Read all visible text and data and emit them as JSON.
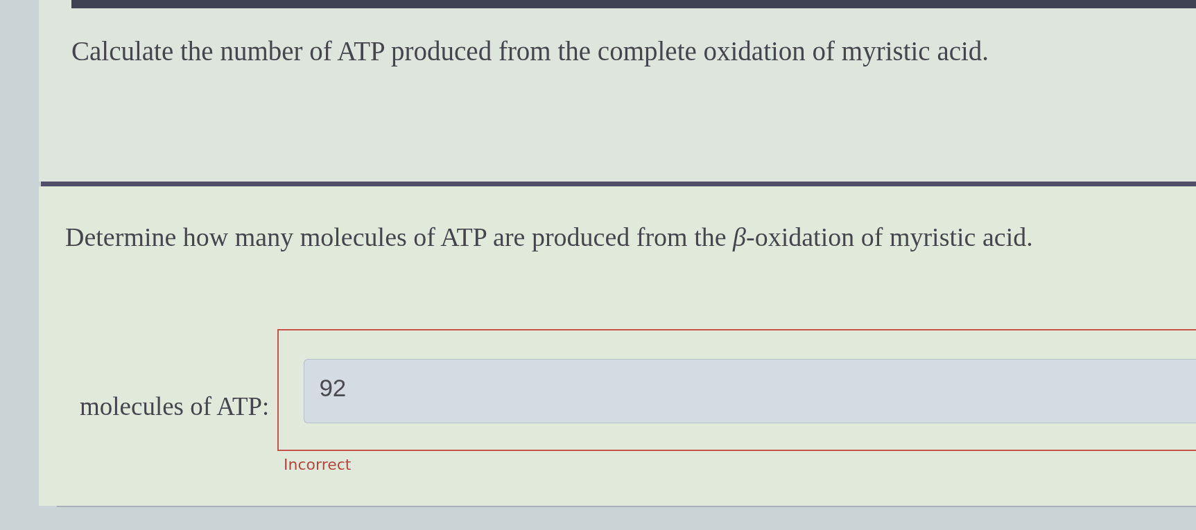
{
  "questions": [
    {
      "text": "Calculate the number of ATP produced from the complete oxidation of myristic acid."
    },
    {
      "text": "Determine how many molecules of ATP are produced from the *β*-oxidation of myristic acid.",
      "answer": {
        "label": "molecules of ATP:",
        "value": "92",
        "feedback": "Incorrect",
        "correct": false
      }
    }
  ]
}
